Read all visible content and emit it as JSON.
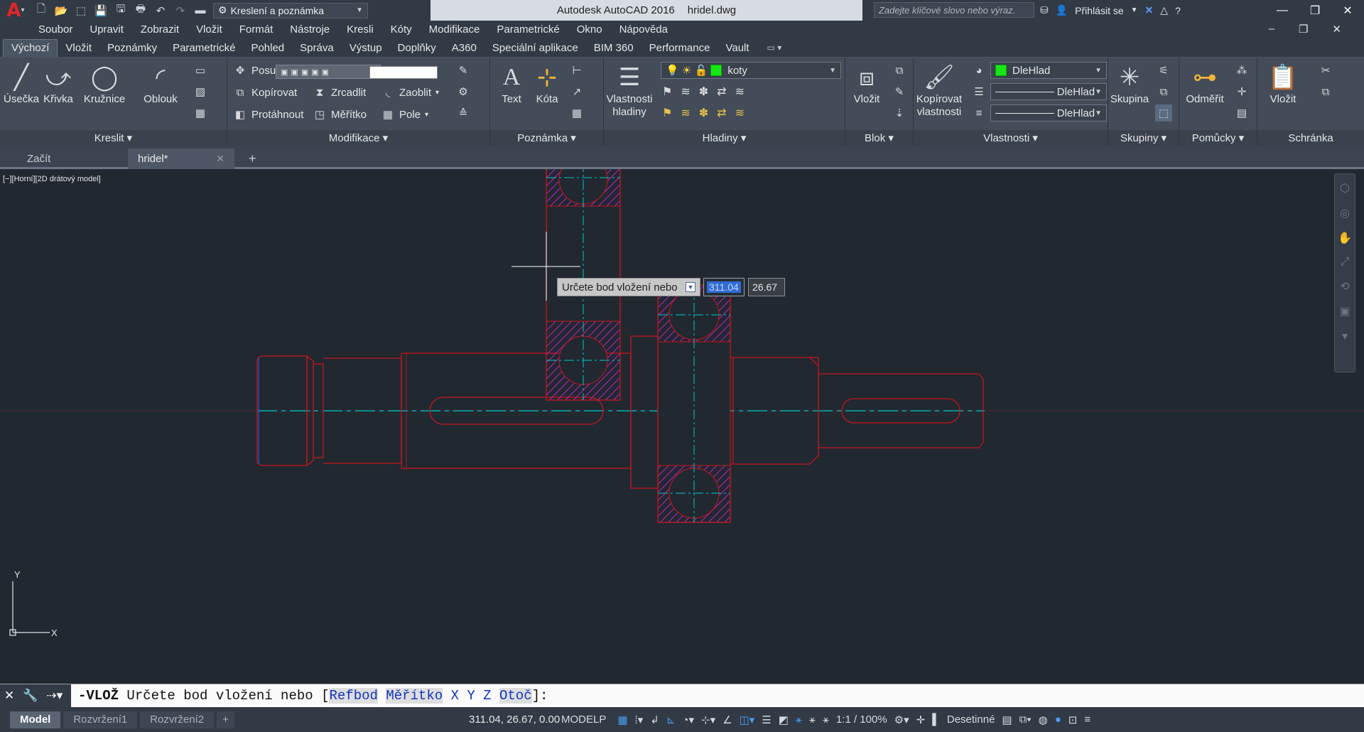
{
  "title": {
    "app": "Autodesk AutoCAD 2016",
    "file": "hridel.dwg"
  },
  "workspace": "Kreslení a poznámka",
  "search_placeholder": "Zadejte klíčové slovo nebo výraz.",
  "signin": "Přihlásit se",
  "menu": [
    "Soubor",
    "Upravit",
    "Zobrazit",
    "Vložit",
    "Formát",
    "Nástroje",
    "Kresli",
    "Kóty",
    "Modifikace",
    "Parametrické",
    "Okno",
    "Nápověda"
  ],
  "ribbon_tabs": [
    "Výchozí",
    "Vložit",
    "Poznámky",
    "Parametrické",
    "Pohled",
    "Správa",
    "Výstup",
    "Doplňky",
    "A360",
    "Speciální aplikace",
    "BIM 360",
    "Performance",
    "Vault"
  ],
  "panels": {
    "kreslit": {
      "title": "Kreslit",
      "line": "Úsečka",
      "polyline": "Křivka",
      "circle": "Kružnice",
      "arc": "Oblouk"
    },
    "modifikace": {
      "title": "Modifikace",
      "move": "Posun",
      "copy": "Kopírovat",
      "mirror": "Zrcadlit",
      "fillet": "Zaoblit",
      "stretch": "Protáhnout",
      "scale": "Měřítko",
      "array": "Pole"
    },
    "poznamka": {
      "title": "Poznámka",
      "text": "Text",
      "dim": "Kóta"
    },
    "hladiny": {
      "title": "Hladiny",
      "props": "Vlastnosti hladiny",
      "layer": "koty"
    },
    "blok": {
      "title": "Blok",
      "insert": "Vložit"
    },
    "vlastnosti": {
      "title": "Vlastnosti",
      "match": "Kopírovat vlastnosti",
      "color": "DleHlad",
      "linetype": "DleHlad",
      "lineweight": "DleHlad"
    },
    "skupiny": {
      "title": "Skupiny",
      "group": "Skupina"
    },
    "pomucky": {
      "title": "Pomůcky",
      "measure": "Odměřit"
    },
    "schranka": {
      "title": "Schránka",
      "paste": "Vložit"
    }
  },
  "file_tabs": [
    {
      "label": "Začít"
    },
    {
      "label": "hridel*"
    }
  ],
  "viewport_label": "[−][Horní][2D drátový model]",
  "dyn_input": {
    "prompt": "Určete bod vložení nebo",
    "x": "311.04",
    "y": "26.67"
  },
  "command": {
    "name": "-VLOŽ",
    "prompt": "Určete bod vložení nebo",
    "options": [
      "Refbod",
      "Měřítko",
      "X",
      "Y",
      "Z",
      "Otoč"
    ]
  },
  "layout_tabs": [
    "Model",
    "Rozvržení1",
    "Rozvržení2"
  ],
  "status": {
    "coords": "311.04, 26.67, 0.00",
    "space": "MODELP",
    "scale": "1:1 / 100%",
    "units": "Desetinné"
  },
  "colors": {
    "drawing": "#c8161d",
    "center": "#00c8c8",
    "hatch": "#c020c0",
    "background": "#212830"
  }
}
